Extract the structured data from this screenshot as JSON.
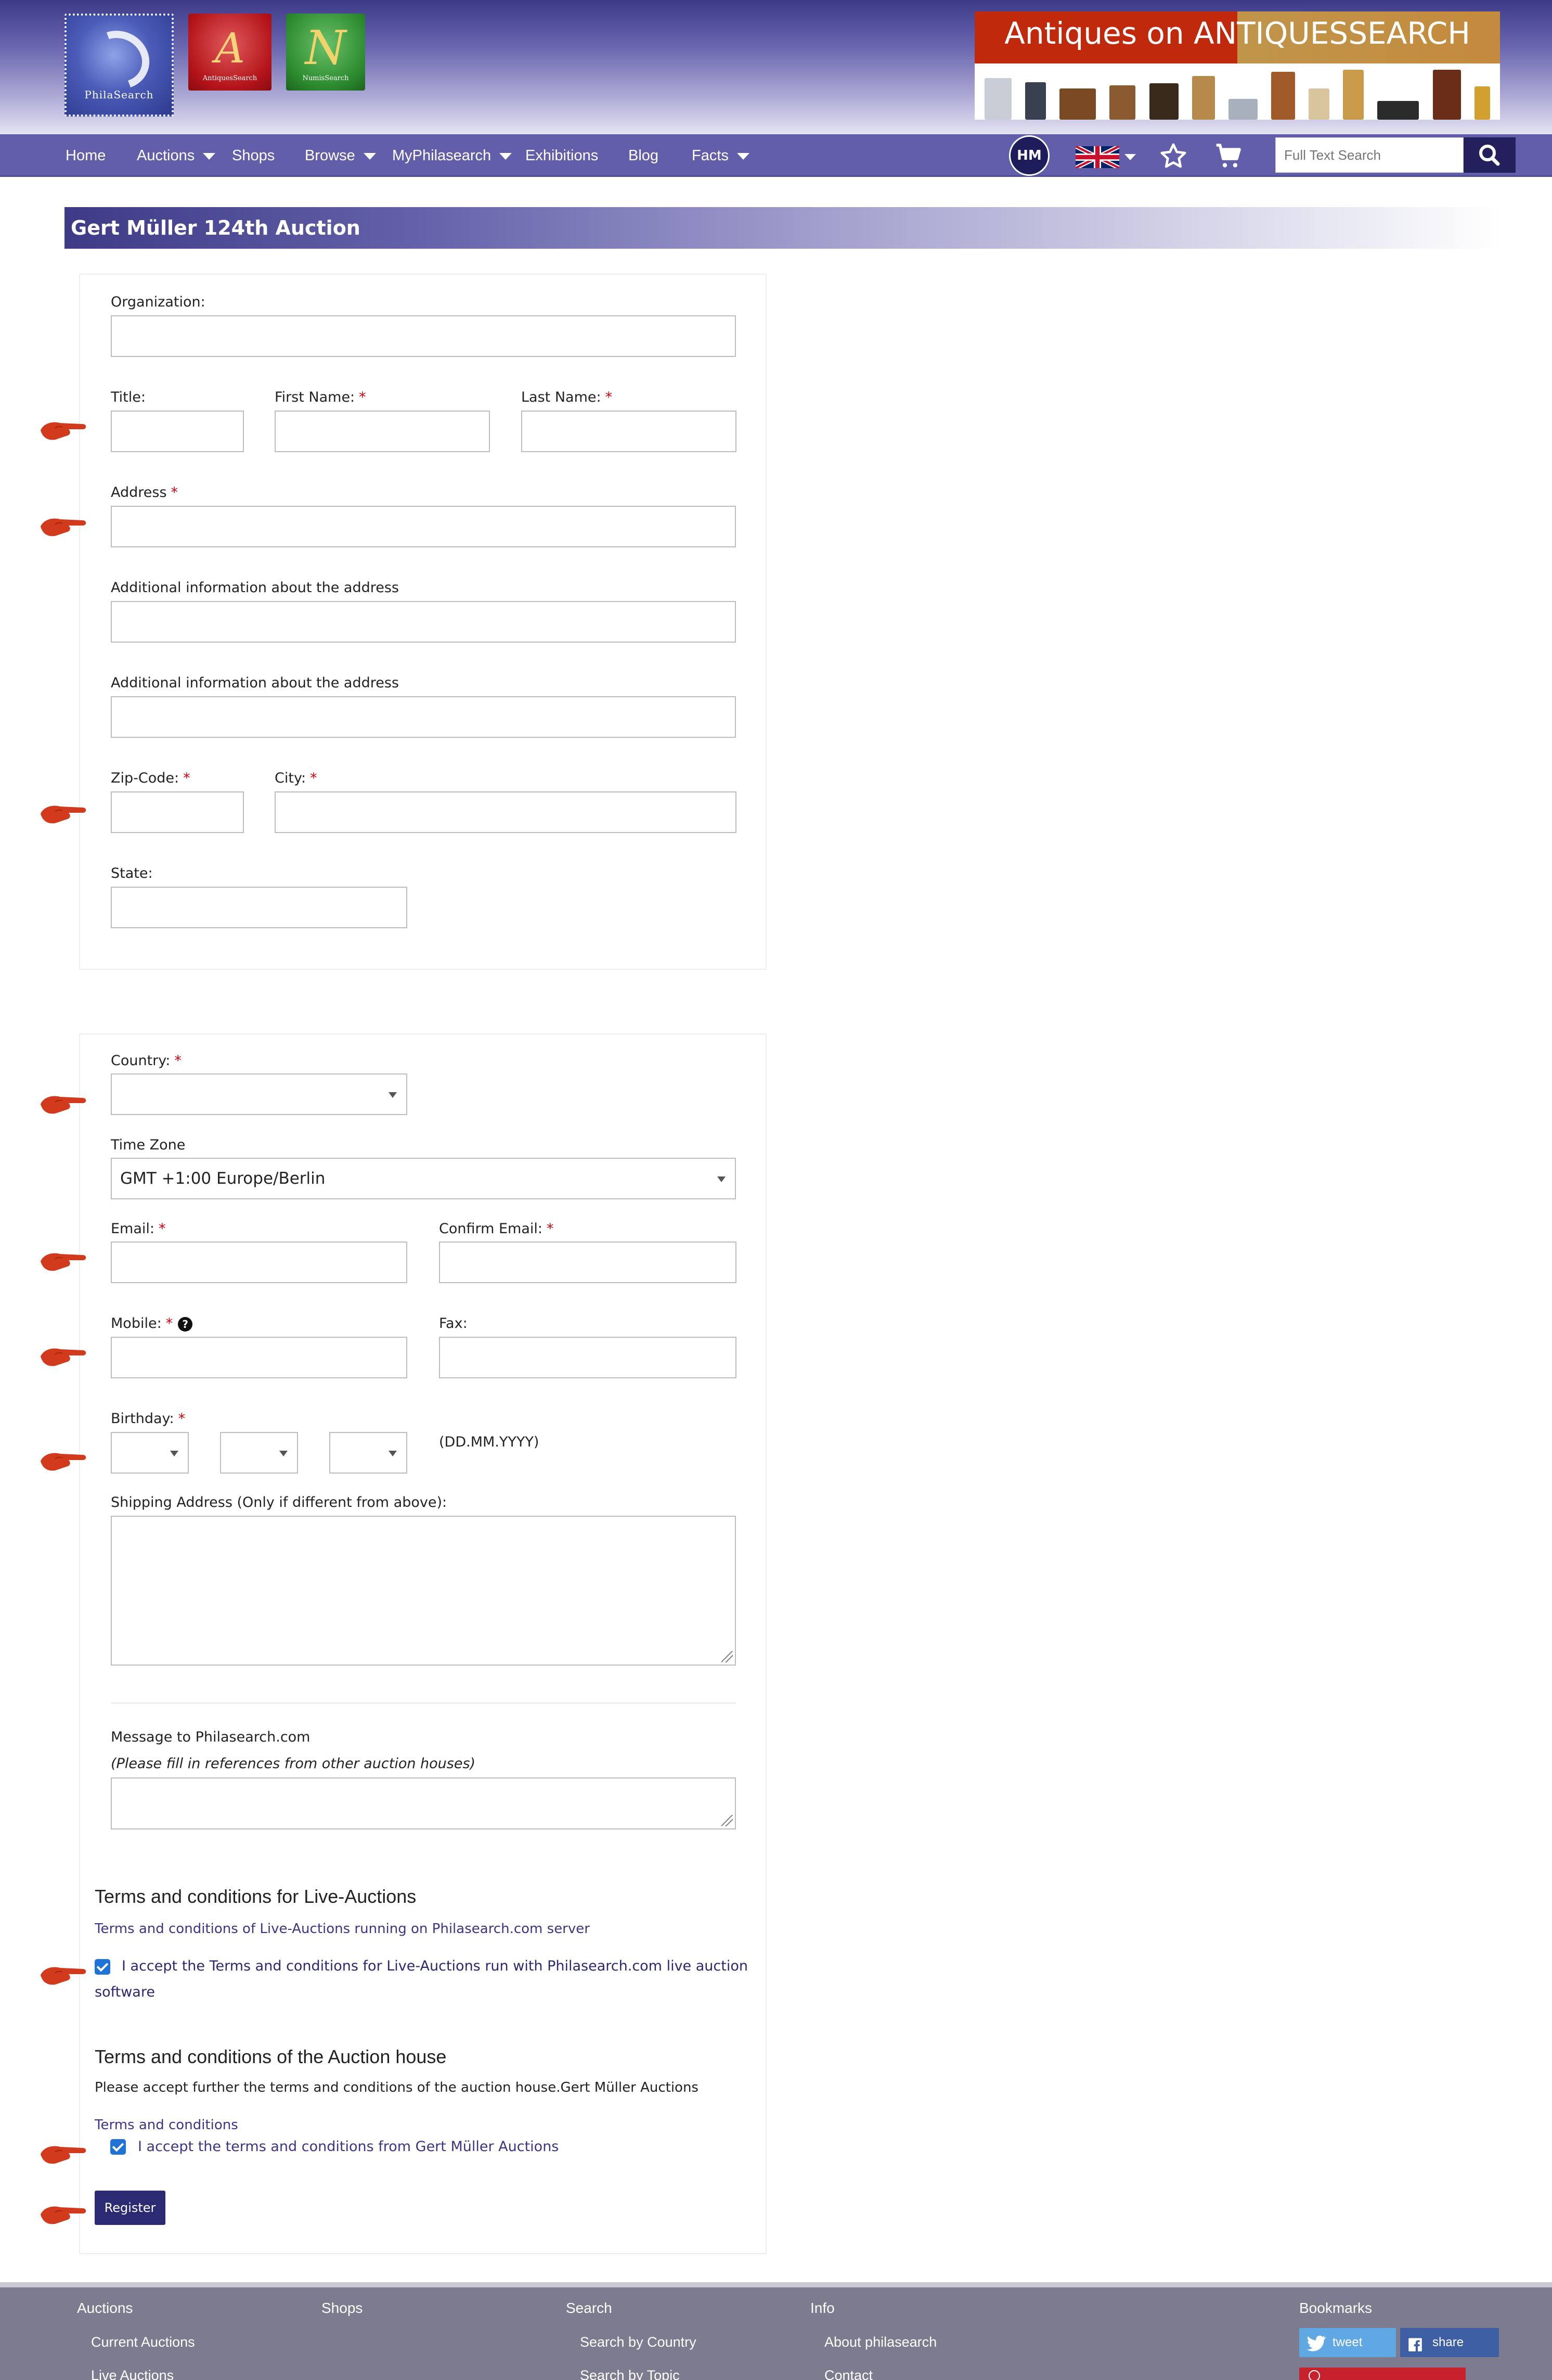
{
  "header": {
    "logos": {
      "philasearch": "PhilaSearch",
      "antiquesearch": "AntiquesSearch",
      "numisearch": "NumisSearch"
    },
    "banner_title": "Antiques on ANTIQUESSEARCH"
  },
  "nav": {
    "items": [
      {
        "label": "Home",
        "dropdown": false
      },
      {
        "label": "Auctions",
        "dropdown": true
      },
      {
        "label": "Shops",
        "dropdown": false
      },
      {
        "label": "Browse",
        "dropdown": true
      },
      {
        "label": "MyPhilasearch",
        "dropdown": true
      },
      {
        "label": "Exhibitions",
        "dropdown": false
      },
      {
        "label": "Blog",
        "dropdown": false
      },
      {
        "label": "Facts",
        "dropdown": true
      }
    ],
    "avatar_initials": "HM",
    "search_placeholder": "Full Text Search",
    "icons": [
      "uk-flag-icon",
      "star-icon",
      "cart-icon",
      "search-icon"
    ]
  },
  "page_title": "Gert Müller 124th Auction",
  "form": {
    "organization_label": "Organization:",
    "title_label": "Title:",
    "first_name_label": "First Name:",
    "last_name_label": "Last Name:",
    "address_label": "Address",
    "additional_info_1_label": "Additional information about the address",
    "additional_info_2_label": "Additional information about the address",
    "zip_label": "Zip-Code:",
    "city_label": "City:",
    "state_label": "State:",
    "country_label": "Country:",
    "country_value": "",
    "timezone_label": "Time Zone",
    "timezone_value": "GMT +1:00 Europe/Berlin",
    "email_label": "Email:",
    "confirm_email_label": "Confirm Email:",
    "mobile_label": "Mobile:",
    "fax_label": "Fax:",
    "birthday_label": "Birthday:",
    "birthday_format": "(DD.MM.YYYY)",
    "shipping_label": "Shipping Address (Only if different from above):",
    "message_label": "Message to Philasearch.com",
    "message_hint": "(Please fill in references from other auction houses)",
    "required_mark": "*",
    "help_mark": "?"
  },
  "terms": {
    "live_heading": "Terms and conditions for Live-Auctions",
    "live_link": "Terms and conditions of Live-Auctions running on Philasearch.com server",
    "live_accept_line1": "I accept the Terms and conditions for Live-Auctions run with Philasearch.com live auction",
    "live_accept_line2": "software",
    "live_accepted": true,
    "house_heading": "Terms and conditions of the Auction house",
    "house_text": "Please accept further the terms and conditions of the auction house.Gert Müller Auctions",
    "house_link": "Terms and conditions",
    "house_accept": "I accept the terms and conditions from Gert Müller Auctions",
    "house_accepted": true
  },
  "register_label": "Register",
  "footer": {
    "columns": [
      {
        "heading": "Auctions",
        "links": [
          "Current Auctions",
          "Live Auctions"
        ]
      },
      {
        "heading": "Shops",
        "links": []
      },
      {
        "heading": "Search",
        "links": [
          "Search by Country",
          "Search by Topic"
        ]
      },
      {
        "heading": "Info",
        "links": [
          "About philasearch",
          "Contact"
        ]
      }
    ],
    "bookmarks_heading": "Bookmarks",
    "tweet_label": "tweet",
    "share_label": "share"
  },
  "colors": {
    "nav_bg": "#635ea9",
    "title_bar": "#3e3a86",
    "required": "#d9000d",
    "link": "#3b3587",
    "checkbox": "#1f72d6",
    "register_bg": "#2d2a74",
    "footer_bg": "#7c7b8f",
    "pointer": "#d23a1e"
  }
}
